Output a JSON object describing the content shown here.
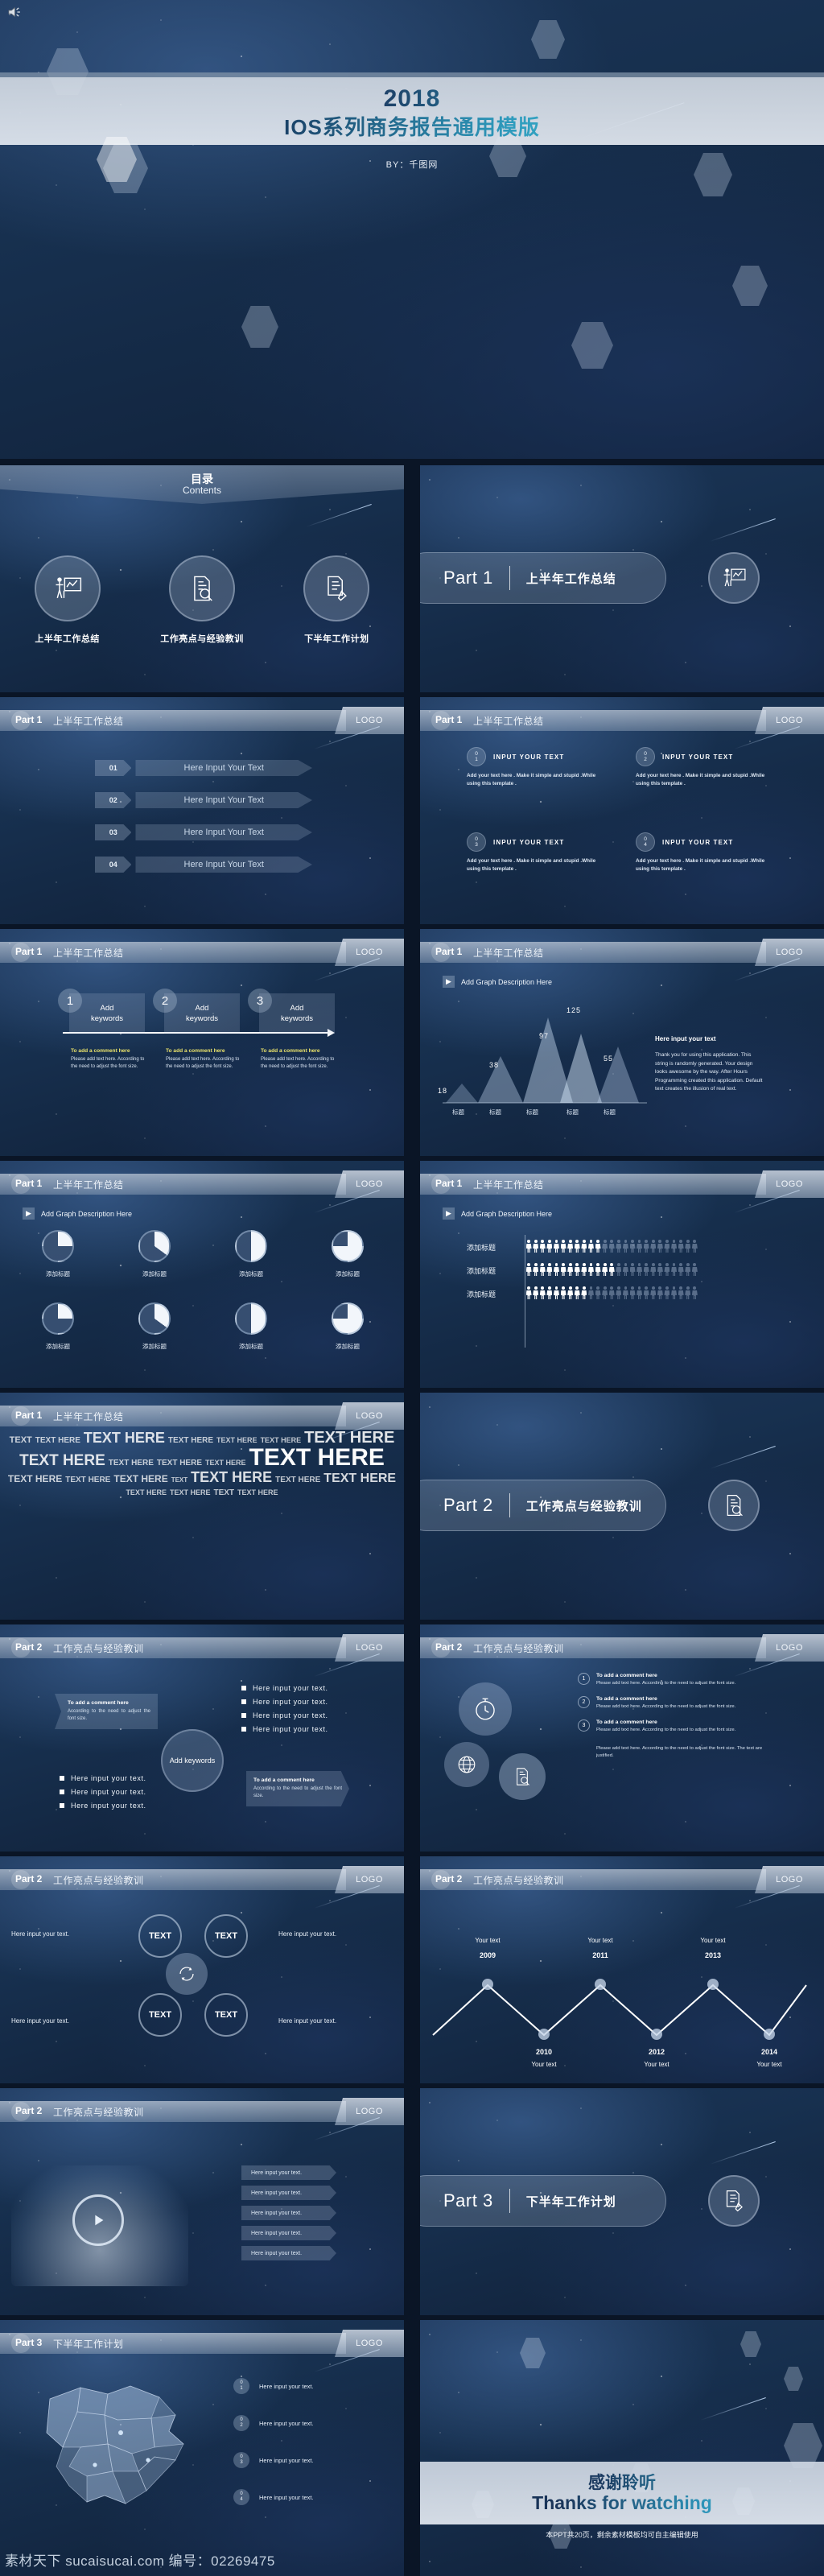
{
  "cover": {
    "year": "2018",
    "title": "IOS系列商务报告通用模版",
    "by": "BY：千图网",
    "speaker_icon": "speaker-icon"
  },
  "contents": {
    "title_cn": "目录",
    "title_en": "Contents",
    "items": [
      {
        "label": "上半年工作总结",
        "icon": "presenter-chart-icon"
      },
      {
        "label": "工作亮点与经验教训",
        "icon": "document-search-icon"
      },
      {
        "label": "下半年工作计划",
        "icon": "document-pencil-icon"
      }
    ]
  },
  "parts": [
    {
      "no": "Part 1",
      "title": "上半年工作总结",
      "icon": "presenter-chart-icon"
    },
    {
      "no": "Part 2",
      "title": "工作亮点与经验教训",
      "icon": "document-search-icon"
    },
    {
      "no": "Part 3",
      "title": "下半年工作计划",
      "icon": "document-pencil-icon"
    }
  ],
  "header": {
    "logo": "LOGO"
  },
  "common": {
    "graph_desc": "Add Graph Description Here",
    "add_title_cn": "添加标题",
    "axis_title_cn": "标题",
    "input_text_placeholder": "Here Input Your Text",
    "here_input_your_text": "Here input your text.",
    "here_input_your_text_h": "Here input your text",
    "add_keywords": "Add keywords",
    "add_keywords_2": "Add\nkeywords",
    "comment_head": "To add a comment here",
    "comment_body": "Please add text here. According to the need to adjust the font size.",
    "comment_body2": "According to the need to adjust the font size.",
    "input_your_text_caps": "INPUT YOUR TEXT",
    "lorem_short": "Add your text here . Make it simple and stupid .While using this template .",
    "lorem_long": "Thank you for using this application. This string is randomly generated. Your design looks awesome by the way. After Hours Programming created this application. Default text creates the illusion of real text.",
    "lorem_note": "Please add text here. According to the need to adjust the font size. The text are justified.",
    "your_text": "Your text",
    "text_word": "TEXT",
    "text_here_word": "TEXT HERE"
  },
  "slide_chevrons": {
    "numbers": [
      "01",
      "02",
      "03",
      "04"
    ]
  },
  "slide_numbered": {
    "numbers": [
      [
        "0",
        "1"
      ],
      [
        "0",
        "2"
      ],
      [
        "0",
        "3"
      ],
      [
        "0",
        "4"
      ]
    ]
  },
  "slide_keywords": {
    "numbers": [
      "1",
      "2",
      "3"
    ]
  },
  "chart_data": [
    {
      "type": "area",
      "title": "Add Graph Description Here",
      "categories": [
        "标题",
        "标题",
        "标题",
        "标题",
        "标题"
      ],
      "values": [
        18,
        38,
        97,
        125,
        55
      ],
      "xlabel": "",
      "ylabel": "",
      "ylim": [
        0,
        140
      ],
      "grid": false,
      "legend": "none",
      "sidebar_heading": "Here input your text",
      "sidebar_body": "Thank you for using this application. This string is randomly generated. Your design looks awesome by the way. After Hours Programming created this application. Default text creates the illusion of real text."
    },
    {
      "type": "pie",
      "title": "Add Graph Description Here",
      "categories": [
        "添加标题",
        "添加标题",
        "添加标题",
        "添加标题"
      ],
      "series": [
        {
          "name": "row1",
          "values": [
            25,
            35,
            50,
            75
          ]
        },
        {
          "name": "row2",
          "values": [
            25,
            35,
            50,
            75
          ]
        }
      ]
    },
    {
      "type": "bar",
      "title": "Add Graph Description Here",
      "categories": [
        "添加标题",
        "添加标题",
        "添加标题"
      ],
      "values": [
        52,
        62,
        42
      ],
      "unit": "person-icons (total 25)",
      "ylim": [
        0,
        100
      ]
    },
    {
      "type": "line",
      "title": "",
      "x": [
        "2009",
        "2010",
        "2011",
        "2012",
        "2013",
        "2014"
      ],
      "values": [
        70,
        20,
        70,
        20,
        70,
        20
      ],
      "point_labels": [
        "Your text",
        "Your text",
        "Your text",
        "Your text",
        "Your text",
        "Your text"
      ],
      "grid": false,
      "legend": "none"
    }
  ],
  "timeline": {
    "years": [
      "2009",
      "2010",
      "2011",
      "2012",
      "2013",
      "2014"
    ],
    "label": "Your text"
  },
  "pictogram": {
    "rows": [
      {
        "label": "添加标题",
        "filled": 11,
        "total": 25
      },
      {
        "label": "添加标题",
        "filled": 13,
        "total": 25
      },
      {
        "label": "添加标题",
        "filled": 9,
        "total": 25
      }
    ]
  },
  "pies": {
    "labels": [
      "添加标题",
      "添加标题",
      "添加标题",
      "添加标题"
    ],
    "percents_row1": [
      25,
      35,
      50,
      75
    ],
    "percents_row2": [
      25,
      35,
      50,
      75
    ]
  },
  "wordcloud": {
    "words": [
      {
        "t": "TEXT",
        "s": 11
      },
      {
        "t": "TEXT HERE",
        "s": 10
      },
      {
        "t": "TEXT HERE",
        "s": 18
      },
      {
        "t": "TEXT HERE",
        "s": 10
      },
      {
        "t": "TEXT HERE",
        "s": 9
      },
      {
        "t": "TEXT HERE",
        "s": 9
      },
      {
        "t": "TEXT HERE",
        "s": 20
      },
      {
        "t": "TEXT HERE",
        "s": 19
      },
      {
        "t": "TEXT HERE",
        "s": 10
      },
      {
        "t": "TEXT HERE",
        "s": 10
      },
      {
        "t": "TEXT HERE",
        "s": 9
      },
      {
        "t": "TEXT HERE",
        "s": 30
      },
      {
        "t": "TEXT HERE",
        "s": 12
      },
      {
        "t": "TEXT HERE",
        "s": 10
      },
      {
        "t": "TEXT HERE",
        "s": 12
      },
      {
        "t": "TEXT",
        "s": 8
      },
      {
        "t": "TEXT HERE",
        "s": 18
      },
      {
        "t": "TEXT HERE",
        "s": 10
      },
      {
        "t": "TEXT HERE",
        "s": 16
      },
      {
        "t": "TEXT HERE",
        "s": 9
      },
      {
        "t": "TEXT HERE",
        "s": 9
      },
      {
        "t": "TEXT",
        "s": 10
      },
      {
        "t": "TEXT HERE",
        "s": 9
      }
    ]
  },
  "map_slide": {
    "items": [
      "Here input your text.",
      "Here input your text.",
      "Here input your text.",
      "Here input your text."
    ],
    "numbers": [
      [
        "0",
        "1"
      ],
      [
        "0",
        "2"
      ],
      [
        "0",
        "3"
      ],
      [
        "0",
        "4"
      ]
    ]
  },
  "thanks": {
    "cn": "感谢聆听",
    "en": "Thanks for watching",
    "note": "本PPT共20页，剩余素材模板均可自主编辑使用"
  },
  "watermark": "素材天下 sucaisucai.com 编号：02269475",
  "colors": {
    "accent_cyan": "#46c9d6",
    "deep_navy": "#13294a",
    "panel": "#b2c4da",
    "highlight_yellow": "#e9e26b"
  }
}
